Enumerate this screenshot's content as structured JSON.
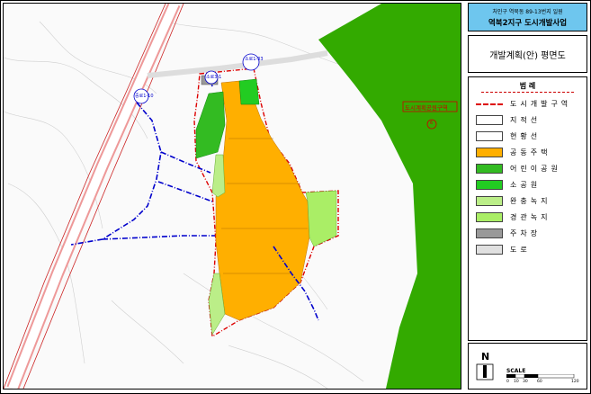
{
  "project": {
    "subtitle": "처인구 역북동 89-13번지 일원",
    "title": "역북2지구 도시개발사업",
    "map_title": "개발계획(안) 평면도"
  },
  "legend": {
    "title": "범 례",
    "items": [
      {
        "label": "도시개발구역",
        "color": "#ffffff",
        "style": "boundary",
        "name": "legend-urban-development-area"
      },
      {
        "label": "지적선",
        "color": "#ffffff",
        "style": "fill",
        "name": "legend-cadastral-line"
      },
      {
        "label": "현황선",
        "color": "#ffffff",
        "style": "fill",
        "name": "legend-status-line"
      },
      {
        "label": "공동주택",
        "color": "#ffaf00",
        "style": "fill",
        "name": "legend-apartment"
      },
      {
        "label": "어린이공원",
        "color": "#33bb22",
        "style": "fill",
        "name": "legend-children-park"
      },
      {
        "label": "소공원",
        "color": "#22cc22",
        "style": "fill",
        "name": "legend-small-park"
      },
      {
        "label": "완충녹지",
        "color": "#bbee88",
        "style": "fill",
        "name": "legend-buffer-green"
      },
      {
        "label": "경관녹지",
        "color": "#aaee66",
        "style": "fill",
        "name": "legend-landscape-green"
      },
      {
        "label": "주차장",
        "color": "#999999",
        "style": "fill",
        "name": "legend-parking"
      },
      {
        "label": "도로",
        "color": "#e0e0e0",
        "style": "fill",
        "name": "legend-road"
      }
    ]
  },
  "map_labels": {
    "road_top": "소로1-33",
    "road_mid": "소로3-1",
    "road_left": "중로1-10",
    "boundary_note": "도시계획공원구역",
    "circle_mark": "6"
  },
  "scale": {
    "north": "N",
    "label": "SCALE",
    "ticks": [
      "0",
      "10",
      "30",
      "60",
      "120"
    ]
  },
  "colors": {
    "title_bg": "#6ec6ee",
    "apartment": "#ffaf00",
    "park_forest": "#33aa00",
    "boundary": "#dd0000",
    "road_plan": "#0000cc"
  }
}
